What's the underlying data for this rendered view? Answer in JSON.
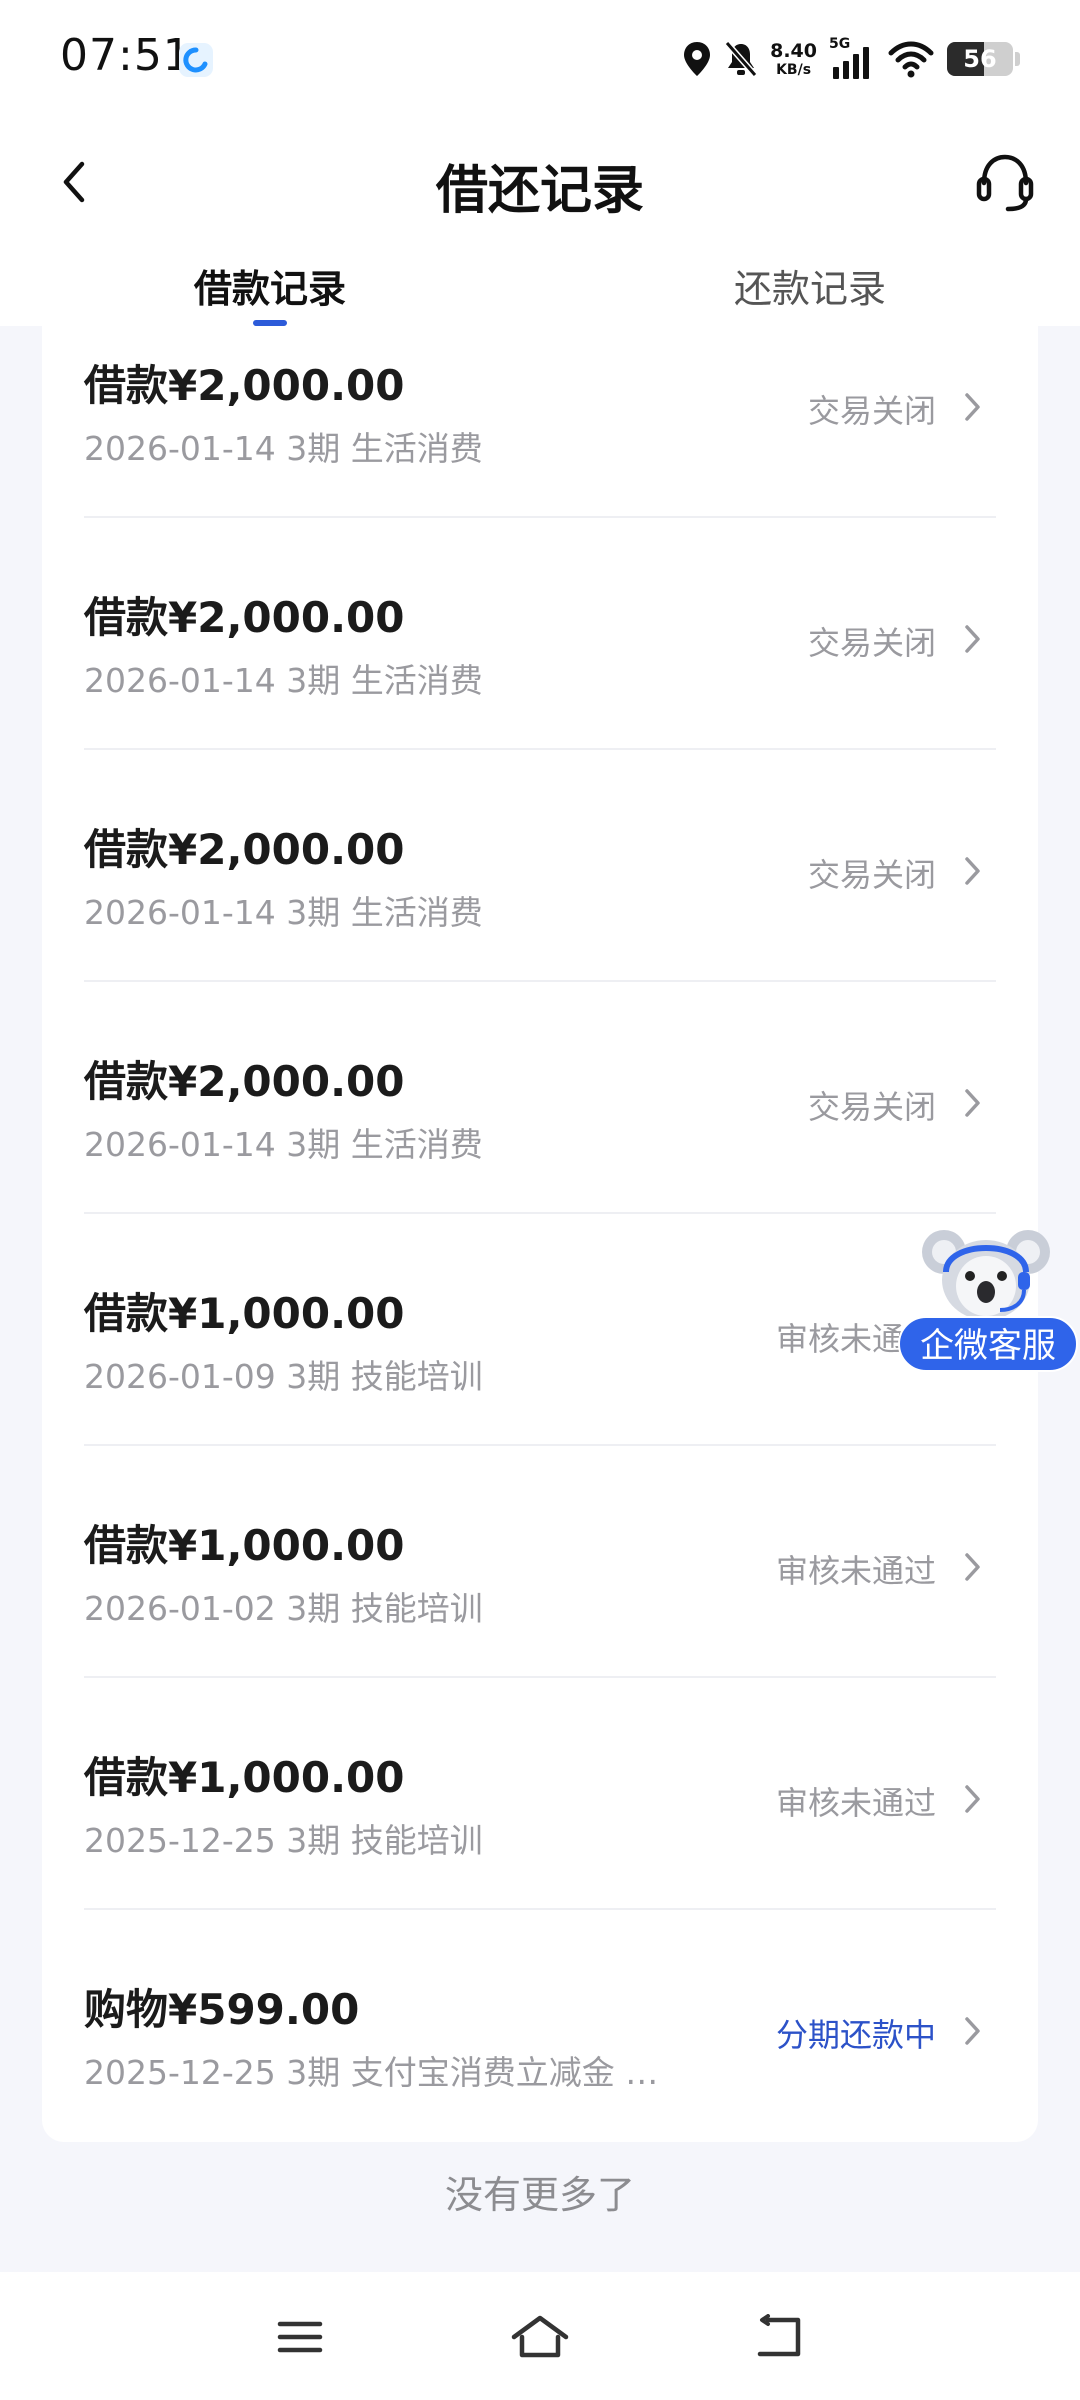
{
  "status_bar": {
    "time": "07:51",
    "net_speed_value": "8.40",
    "net_speed_unit": "KB/s",
    "network_type": "5G",
    "battery": "56",
    "battery_level": 0.56
  },
  "header": {
    "title": "借还记录"
  },
  "tabs": [
    {
      "label": "借款记录",
      "active": true
    },
    {
      "label": "还款记录",
      "active": false
    }
  ],
  "records": [
    {
      "type": "借款",
      "amount": "¥2,000.00",
      "date": "2026-01-14",
      "periods": "3期",
      "purpose": "生活消费",
      "status": "交易关闭"
    },
    {
      "type": "借款",
      "amount": "¥2,000.00",
      "date": "2026-01-14",
      "periods": "3期",
      "purpose": "生活消费",
      "status": "交易关闭"
    },
    {
      "type": "借款",
      "amount": "¥2,000.00",
      "date": "2026-01-14",
      "periods": "3期",
      "purpose": "生活消费",
      "status": "交易关闭"
    },
    {
      "type": "借款",
      "amount": "¥2,000.00",
      "date": "2026-01-14",
      "periods": "3期",
      "purpose": "生活消费",
      "status": "交易关闭"
    },
    {
      "type": "借款",
      "amount": "¥1,000.00",
      "date": "2026-01-09",
      "periods": "3期",
      "purpose": "技能培训",
      "status": "审核未通过"
    },
    {
      "type": "借款",
      "amount": "¥1,000.00",
      "date": "2026-01-02",
      "periods": "3期",
      "purpose": "技能培训",
      "status": "审核未通过"
    },
    {
      "type": "借款",
      "amount": "¥1,000.00",
      "date": "2025-12-25",
      "periods": "3期",
      "purpose": "技能培训",
      "status": "审核未通过"
    },
    {
      "type": "购物",
      "amount": "¥599.00",
      "date": "2025-12-25",
      "periods": "3期",
      "purpose": "支付宝消费立减金 …",
      "status": "分期还款中"
    }
  ],
  "footer": {
    "no_more": "没有更多了"
  },
  "floating_support": {
    "label": "企微客服"
  },
  "colors": {
    "accent": "#2c52c8",
    "status_muted": "#9a9a9f",
    "float_button": "#2f64ea"
  },
  "icons": {
    "back": "chevron-left-icon",
    "support": "headset-icon",
    "row": "chevron-right-icon",
    "sys_menu": "menu-icon",
    "sys_home": "home-icon",
    "sys_back": "back-icon"
  }
}
